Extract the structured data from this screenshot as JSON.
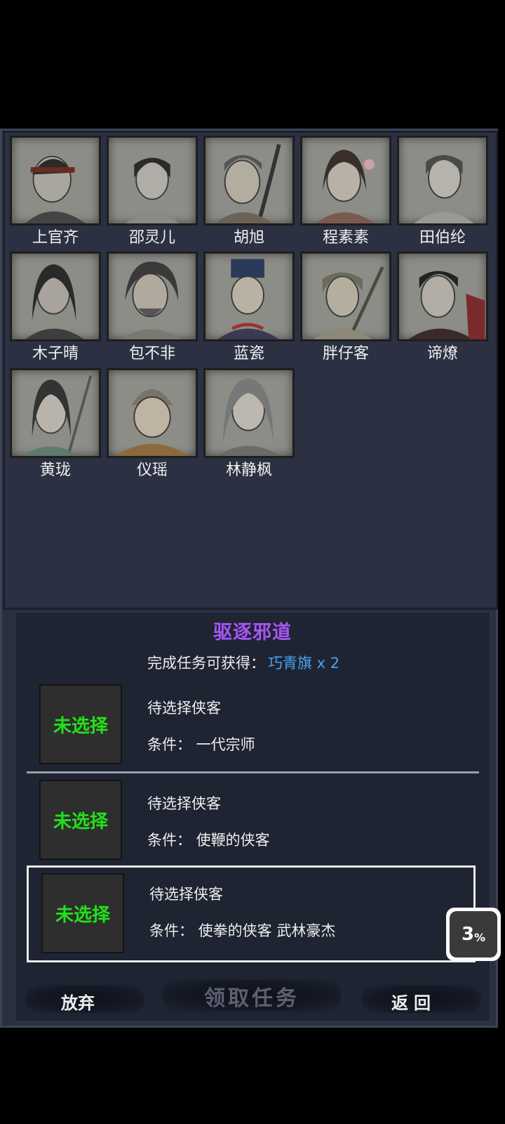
{
  "heroes": [
    {
      "name": "上官齐"
    },
    {
      "name": "邵灵儿"
    },
    {
      "name": "胡旭"
    },
    {
      "name": "程素素"
    },
    {
      "name": "田伯纶"
    },
    {
      "name": "木子晴"
    },
    {
      "name": "包不非"
    },
    {
      "name": "蓝瓷"
    },
    {
      "name": "胖仔客"
    },
    {
      "name": "谛燎"
    },
    {
      "name": "黄珑"
    },
    {
      "name": "仪瑶"
    },
    {
      "name": "林静枫"
    }
  ],
  "quest": {
    "title": "驱逐邪道",
    "reward_label": "完成任务可获得：",
    "reward_item": "巧青旗 x 2",
    "slots": [
      {
        "status": "未选择",
        "line1": "待选择侠客",
        "line2": "条件：  一代宗师"
      },
      {
        "status": "未选择",
        "line1": "待选择侠客",
        "line2": "条件：  使鞭的侠客"
      },
      {
        "status": "未选择",
        "line1": "待选择侠客",
        "line2": "条件：  使拳的侠客  武林豪杰"
      }
    ]
  },
  "buttons": {
    "abandon": "放弃",
    "accept": "领取任务",
    "back": "返回"
  },
  "badge": {
    "value": "3",
    "unit": "%"
  },
  "colors": {
    "title": "#a855f7",
    "reward_item": "#48a2ee",
    "slot_status": "#22e11a"
  }
}
